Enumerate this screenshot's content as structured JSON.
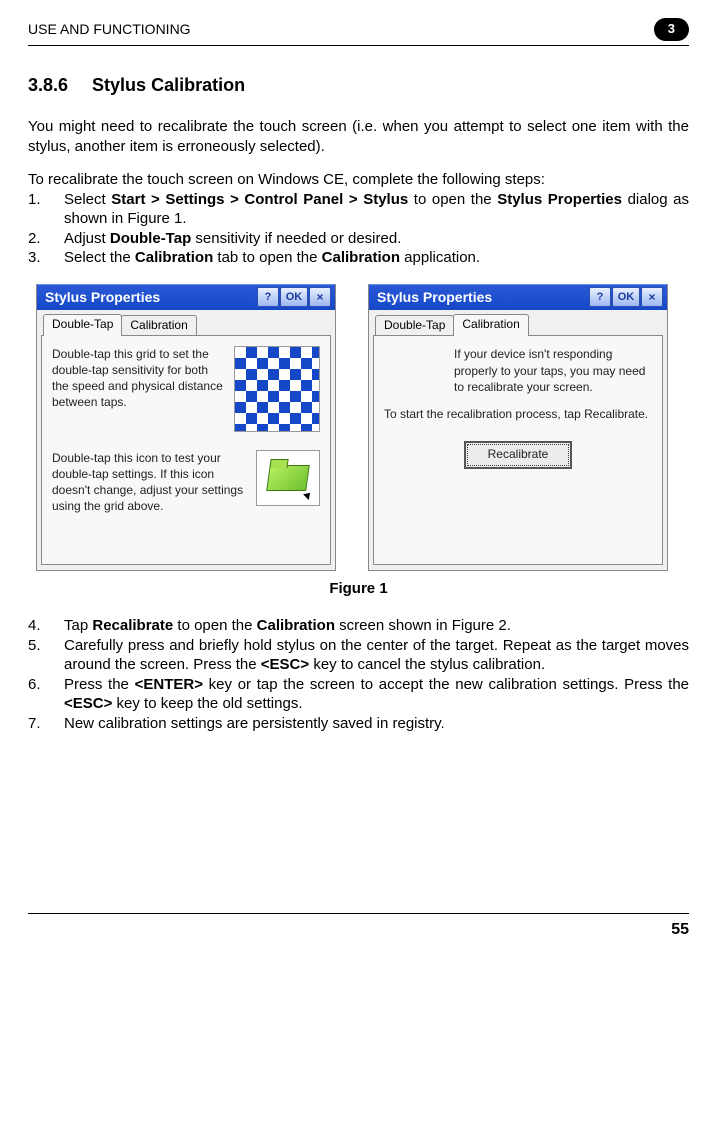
{
  "header": {
    "title": "USE AND FUNCTIONING",
    "chapter": "3"
  },
  "section": {
    "number": "3.8.6",
    "title": "Stylus Calibration"
  },
  "intro1": "You might need to recalibrate the touch screen (i.e. when you attempt to select one item with the stylus, another item is erroneously selected).",
  "intro2": "To recalibrate the touch screen on Windows CE, complete the following steps:",
  "steps_top": {
    "s1_a": "Select ",
    "s1_b": "Start > Settings > Control Panel > Stylus",
    "s1_c": " to open the ",
    "s1_d": "Stylus Properties",
    "s1_e": " dialog as shown in Figure 1.",
    "s2_a": "Adjust ",
    "s2_b": "Double-Tap",
    "s2_c": " sensitivity if needed or desired.",
    "s3_a": "Select the ",
    "s3_b": "Calibration",
    "s3_c": " tab to open the ",
    "s3_d": "Calibration",
    "s3_e": " application."
  },
  "dialogs": {
    "title": "Stylus Properties",
    "help": "?",
    "ok": "OK",
    "close": "×",
    "tab1": "Double-Tap",
    "tab2": "Calibration",
    "dt_text1": "Double-tap this grid to set the double-tap sensitivity for both the speed and physical distance between taps.",
    "dt_text2": "Double-tap this icon to test your double-tap settings. If this icon doesn't change, adjust your settings using the grid above.",
    "cal_text1": "If your device isn't responding properly to your taps, you may need to recalibrate your screen.",
    "cal_text2": "To start the recalibration process, tap Recalibrate.",
    "recalibrate": "Recalibrate"
  },
  "figure_caption": "Figure 1",
  "steps_bottom": {
    "s4_a": "Tap ",
    "s4_b": "Recalibrate",
    "s4_c": " to open the ",
    "s4_d": "Calibration",
    "s4_e": " screen shown in Figure 2.",
    "s5_a": "Carefully press and briefly hold stylus on the center of the target. Repeat as the target moves around the screen. Press the ",
    "s5_b": "<ESC>",
    "s5_c": " key to cancel the stylus calibration.",
    "s6_a": "Press the ",
    "s6_b": "<ENTER>",
    "s6_c": " key or tap the screen to accept the new calibration settings. Press the ",
    "s6_d": "<ESC>",
    "s6_e": " key to keep the old settings.",
    "s7": "New calibration settings are persistently saved in registry."
  },
  "page_number": "55"
}
